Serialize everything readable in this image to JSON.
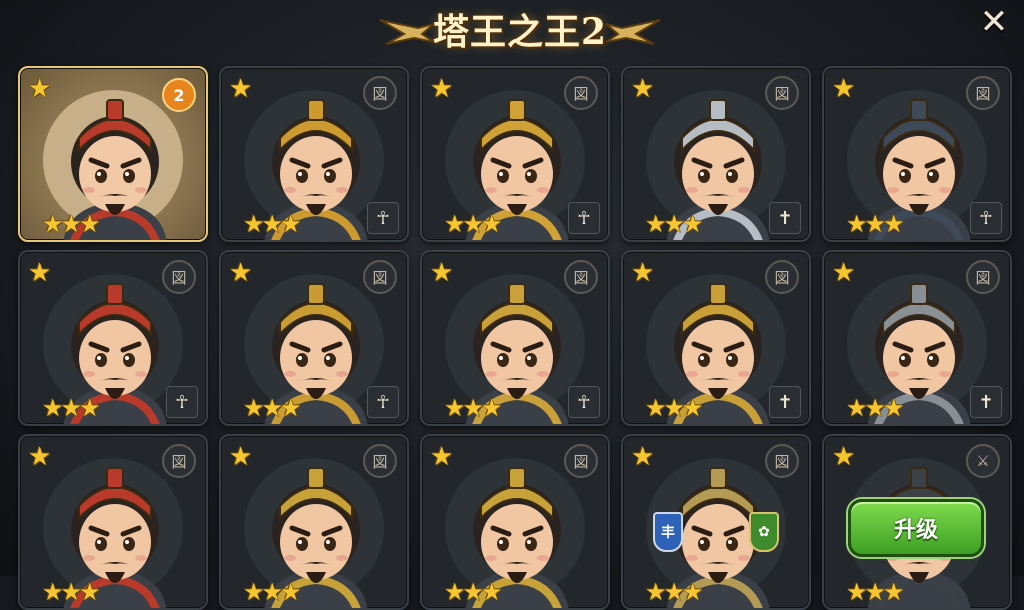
{
  "header": {
    "title": "塔王之王2",
    "close_label": "✕"
  },
  "cards": [
    {
      "id": "r1c1",
      "selected": true,
      "stars": 3,
      "badge": "2",
      "seal": "",
      "rank": "",
      "helmet": "#b83a2a",
      "skin": "#f1c9a6"
    },
    {
      "id": "r1c2",
      "selected": false,
      "stars": 3,
      "badge": "",
      "seal": "図",
      "rank": "☥",
      "helmet": "#cc9a2e",
      "skin": "#f0c7a2"
    },
    {
      "id": "r1c3",
      "selected": false,
      "stars": 3,
      "badge": "",
      "seal": "図",
      "rank": "☥",
      "helmet": "#cfa137",
      "skin": "#f0c7a2"
    },
    {
      "id": "r1c4",
      "selected": false,
      "stars": 3,
      "badge": "",
      "seal": "図",
      "rank": "✝",
      "helmet": "#b7bdc4",
      "skin": "#f0c7a2"
    },
    {
      "id": "r1c5",
      "selected": false,
      "stars": 3,
      "badge": "",
      "seal": "図",
      "rank": "☥",
      "helmet": "#3e4a5a",
      "skin": "#f0c7a2"
    },
    {
      "id": "r2c1",
      "selected": false,
      "stars": 3,
      "badge": "",
      "seal": "図",
      "rank": "☥",
      "helmet": "#b83a2a",
      "skin": "#f0c7a2"
    },
    {
      "id": "r2c2",
      "selected": false,
      "stars": 3,
      "badge": "",
      "seal": "図",
      "rank": "☥",
      "helmet": "#c99b33",
      "skin": "#f0c7a2"
    },
    {
      "id": "r2c3",
      "selected": false,
      "stars": 3,
      "badge": "",
      "seal": "図",
      "rank": "☥",
      "helmet": "#caa03a",
      "skin": "#f0c7a2"
    },
    {
      "id": "r2c4",
      "selected": false,
      "stars": 3,
      "badge": "",
      "seal": "図",
      "rank": "✝",
      "helmet": "#c9a037",
      "skin": "#f0c7a2"
    },
    {
      "id": "r2c5",
      "selected": false,
      "stars": 3,
      "badge": "",
      "seal": "図",
      "rank": "✝",
      "helmet": "#8a8f95",
      "skin": "#f0c7a2"
    },
    {
      "id": "r3c1",
      "selected": false,
      "stars": 3,
      "badge": "",
      "seal": "図",
      "rank": "",
      "helmet": "#b83a2a",
      "skin": "#f0c7a2"
    },
    {
      "id": "r3c2",
      "selected": false,
      "stars": 3,
      "badge": "",
      "seal": "図",
      "rank": "",
      "helmet": "#c7a239",
      "skin": "#f0c7a2"
    },
    {
      "id": "r3c3",
      "selected": false,
      "stars": 3,
      "badge": "",
      "seal": "図",
      "rank": "",
      "helmet": "#c7a239",
      "skin": "#f0c7a2"
    },
    {
      "id": "r3c4",
      "selected": false,
      "stars": 3,
      "badge": "",
      "seal": "図",
      "rank": "",
      "helmet": "#b39a55",
      "skin": "#f0c7a2"
    },
    {
      "id": "r3c5",
      "selected": false,
      "stars": 3,
      "badge": "",
      "seal": "⚔",
      "rank": "",
      "helmet": "#3c4148",
      "skin": "#f0c7a2"
    }
  ],
  "upgrade_button": {
    "label": "升级"
  },
  "colors": {
    "gold": "#f5c631",
    "panel": "#23272c",
    "green": "#5cc33a",
    "select_border": "#e8c77a"
  }
}
